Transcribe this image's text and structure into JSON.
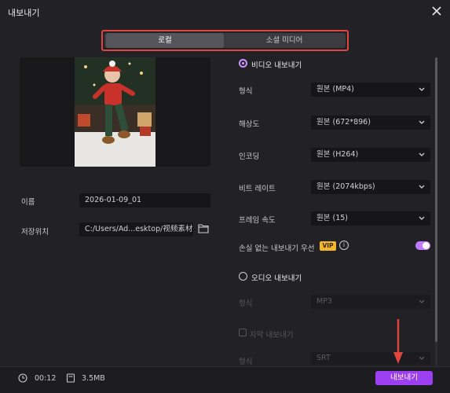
{
  "window": {
    "title": "내보내기"
  },
  "tabs": [
    {
      "label": "로컬",
      "active": true
    },
    {
      "label": "소셜 미디어",
      "active": false
    }
  ],
  "left": {
    "name_label": "이름",
    "name_value": "2026-01-09_01",
    "location_label": "저장위치",
    "location_value": "C:/Users/Ad...esktop/视频素材"
  },
  "video": {
    "section_label": "비디오 내보내기",
    "selected": true,
    "rows": [
      {
        "label": "형식",
        "value": "원본 (MP4)"
      },
      {
        "label": "해상도",
        "value": "원본 (672*896)"
      },
      {
        "label": "인코딩",
        "value": "원본 (H264)"
      },
      {
        "label": "비트 레이트",
        "value": "원본 (2074kbps)"
      },
      {
        "label": "프레임 속도",
        "value": "원본 (15)"
      }
    ],
    "lossless_label": "손실 없는 내보내기 우선",
    "vip_badge": "VIP",
    "info_icon": "i",
    "lossless_enabled": true
  },
  "audio": {
    "section_label": "오디오 내보내기",
    "selected": false,
    "format_label": "형식",
    "format_value": "MP3"
  },
  "subtitle": {
    "checkbox_label": "자막 내보내기",
    "checked": false,
    "format_label": "형식",
    "format_value": "SRT"
  },
  "footer": {
    "duration": "00:12",
    "size": "3.5MB",
    "export_button": "내보내기"
  },
  "colors": {
    "accent": "#9b3ff0",
    "highlight_box": "#e0463f",
    "vip": "#f3b72c",
    "background": "#222226"
  },
  "icons": {
    "close": "close-icon",
    "folder": "folder-icon",
    "clock": "clock-icon",
    "file": "file-icon",
    "chevron": "chevron-down-icon",
    "arrow": "arrow-down-annotation"
  }
}
